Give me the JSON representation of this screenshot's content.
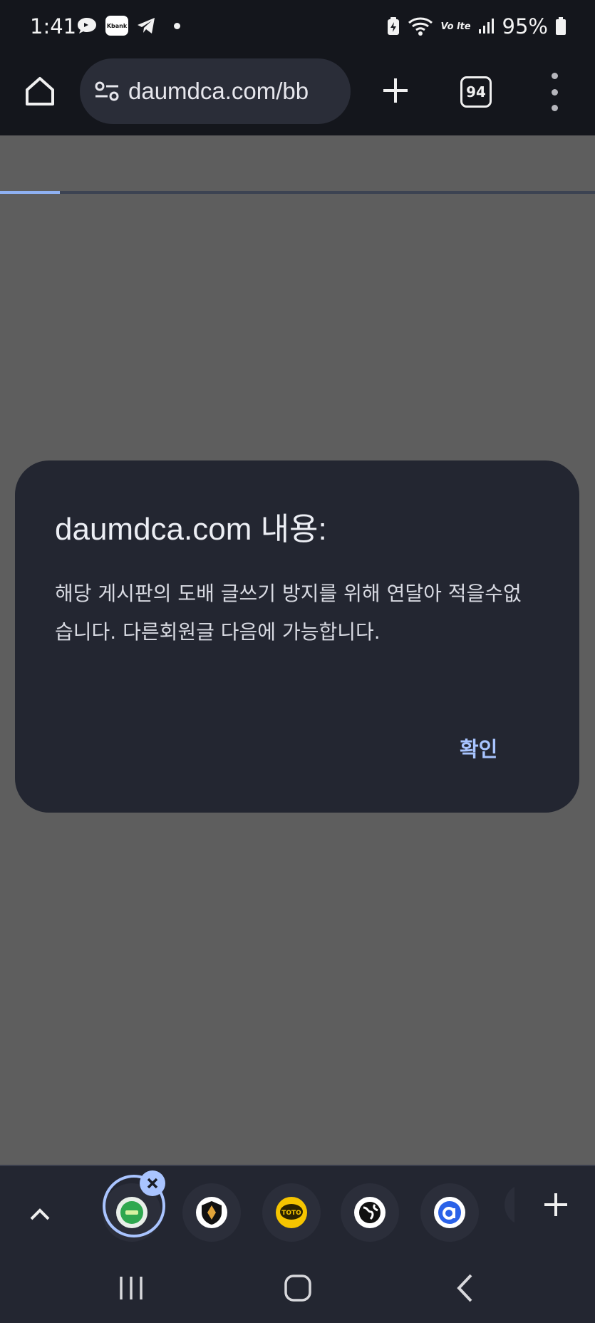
{
  "status": {
    "time": "1:41",
    "kbank_label": "Kbank",
    "network": "Vo lte",
    "battery": "95%"
  },
  "browser": {
    "url": "daumdca.com/bb",
    "tab_count": "94",
    "load_progress": 0.1
  },
  "dialog": {
    "title": "daumdca.com 내용:",
    "message": "해당 게시판의 도배 글쓰기 방지를 위해 연달아 적을수없습니다. 다른회원글 다음에 가능합니다.",
    "ok_label": "확인"
  },
  "tab_strip": {
    "tabs": [
      {
        "icon": "green-site-icon",
        "color": "#2fa84f",
        "active": true
      },
      {
        "icon": "black-shield-icon",
        "color": "#111111",
        "active": false
      },
      {
        "icon": "toto-icon",
        "color": "#f5c400",
        "label": "TOTO",
        "active": false
      },
      {
        "icon": "globe-icon",
        "color": "#111111",
        "active": false
      },
      {
        "icon": "blue-a-icon",
        "color": "#2b62e8",
        "active": false
      }
    ]
  },
  "colors": {
    "accent": "#a8c4ff",
    "dialog_bg": "#232631",
    "scrim": "#5e5e5e"
  }
}
